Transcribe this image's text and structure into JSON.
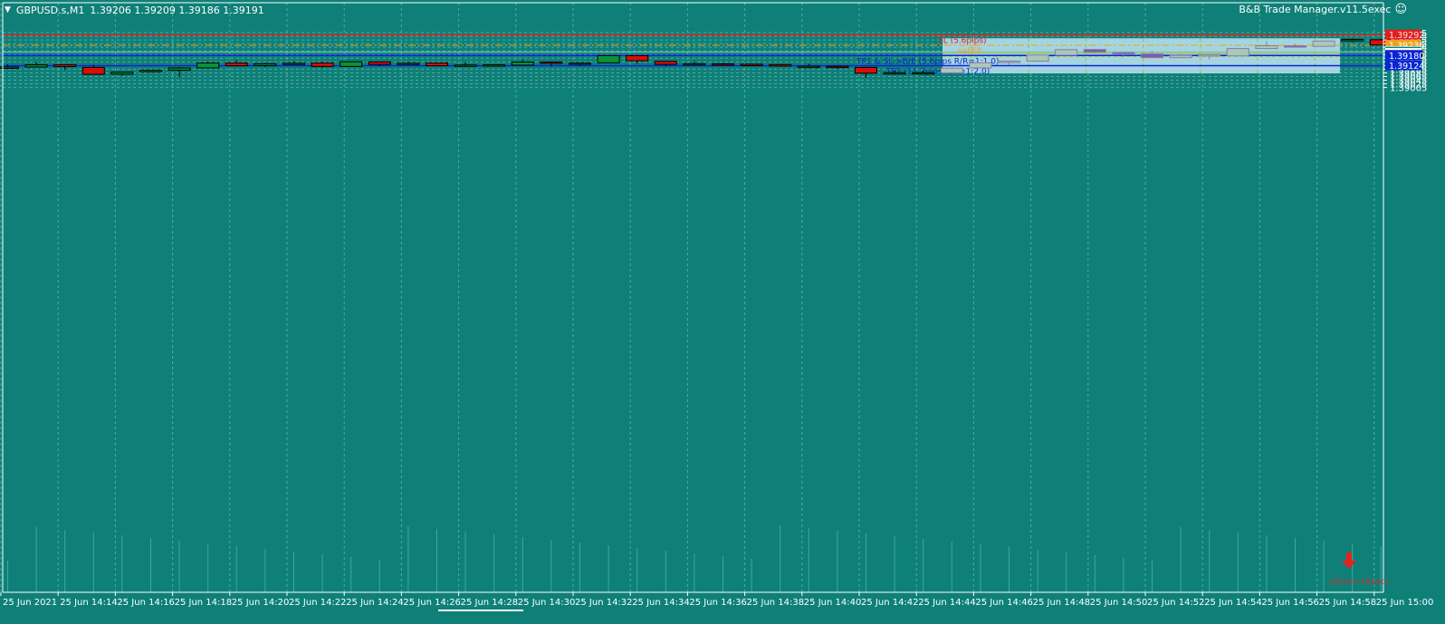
{
  "header": {
    "menu_icon": "triangle-down-icon",
    "symbol": "GBPUSD.s,M1",
    "ohlc": "1.39206 1.39209 1.39186 1.39191"
  },
  "expert_advisor": {
    "name": "B&B Trade Manager.v11.5exec",
    "icon": "smiley-icon"
  },
  "colors": {
    "background": "#0e8078",
    "bull": "#079438",
    "bear": "#d90d0a",
    "sl_line": "#e11f1f",
    "entry_line": "#f0a020",
    "tp_line": "#0a24d4",
    "grid": "#54a8a2",
    "zone": "#add8e6",
    "zone_bull": "#a9c9b8",
    "zone_bear": "#7b5fa8"
  },
  "price_axis": {
    "labels": [
      "1.39305",
      "1.39285",
      "1.39265",
      "1.39245",
      "1.39225",
      "1.39205",
      "1.39185",
      "1.39165",
      "1.39145",
      "1.39125",
      "1.39105",
      "1.39085",
      "1.39065",
      "1.39045",
      "1.39025",
      "1.39005"
    ]
  },
  "price_tags": [
    {
      "text": "1.39292",
      "price": 1.39292,
      "bg": "#e11f1f",
      "fg": "#ffdddd"
    },
    {
      "text": "1.39236",
      "price": 1.39236,
      "bg": "#f0a020",
      "fg": "#ffffff"
    },
    {
      "text": "1.39199",
      "price": 1.39199,
      "bg": "#0e8078",
      "fg": "#0e8078",
      "border": "#a8d8d4"
    },
    {
      "text": "1.39191",
      "price": 1.39191,
      "bg": "#ffffff",
      "fg": "#000000"
    },
    {
      "text": "1.39180",
      "price": 1.3918,
      "bg": "#0a24d4",
      "fg": "#ffffff"
    },
    {
      "text": "1.39124",
      "price": 1.39124,
      "bg": "#0a24d4",
      "fg": "#ffffff"
    }
  ],
  "lines": [
    {
      "name": "sl-line",
      "price": 1.39292,
      "label": "SL (5.6pips)",
      "color": "#e11f1f",
      "style": "solid"
    },
    {
      "name": "sell-entry-line",
      "price": 1.39236,
      "label": "sellEP",
      "color": "#f0a020",
      "style": "dashed"
    },
    {
      "name": "tp1-line",
      "price": 1.3918,
      "label": "TP1 & SL->B/E (5.6pips R/R=1:1.0)",
      "color": "#0a24d4",
      "style": "solid"
    },
    {
      "name": "tp2-line",
      "price": 1.39124,
      "label": "TP2 (11.2pips R/R=1:2.0)",
      "color": "#0a24d4",
      "style": "solid"
    }
  ],
  "time_axis": {
    "labels": [
      "25 Jun 2021",
      "25 Jun 14:14",
      "25 Jun 14:16",
      "25 Jun 14:18",
      "25 Jun 14:20",
      "25 Jun 14:22",
      "25 Jun 14:24",
      "25 Jun 14:26",
      "25 Jun 14:28",
      "25 Jun 14:30",
      "25 Jun 14:32",
      "25 Jun 14:34",
      "25 Jun 14:36",
      "25 Jun 14:38",
      "25 Jun 14:40",
      "25 Jun 14:42",
      "25 Jun 14:44",
      "25 Jun 14:46",
      "25 Jun 14:48",
      "25 Jun 14:50",
      "25 Jun 14:52",
      "25 Jun 14:54",
      "25 Jun 14:56",
      "25 Jun 14:58",
      "25 Jun 15:00"
    ]
  },
  "countdown": {
    "text": "(45min 18sec)",
    "icon": "red-down-arrow-icon"
  },
  "chart_data": {
    "type": "candlestick",
    "title": "GBPUSD.s,M1",
    "ylim": [
      1.39,
      1.39315
    ],
    "candles": [
      {
        "o": 1.39114,
        "h": 1.39132,
        "l": 1.3911,
        "c": 1.39117
      },
      {
        "o": 1.39117,
        "h": 1.39146,
        "l": 1.39115,
        "c": 1.39129
      },
      {
        "o": 1.39129,
        "h": 1.39131,
        "l": 1.39101,
        "c": 1.39119
      },
      {
        "o": 1.39115,
        "h": 1.39128,
        "l": 1.39074,
        "c": 1.39077
      },
      {
        "o": 1.39078,
        "h": 1.3909,
        "l": 1.39069,
        "c": 1.39089
      },
      {
        "o": 1.39091,
        "h": 1.39101,
        "l": 1.39086,
        "c": 1.39099
      },
      {
        "o": 1.39099,
        "h": 1.39117,
        "l": 1.39061,
        "c": 1.39112
      },
      {
        "o": 1.39112,
        "h": 1.39146,
        "l": 1.3911,
        "c": 1.39139
      },
      {
        "o": 1.39139,
        "h": 1.39154,
        "l": 1.39123,
        "c": 1.39124
      },
      {
        "o": 1.39125,
        "h": 1.39141,
        "l": 1.39117,
        "c": 1.39135
      },
      {
        "o": 1.39136,
        "h": 1.39149,
        "l": 1.39133,
        "c": 1.39138
      },
      {
        "o": 1.39139,
        "h": 1.39146,
        "l": 1.39113,
        "c": 1.3912
      },
      {
        "o": 1.3912,
        "h": 1.39146,
        "l": 1.39118,
        "c": 1.39146
      },
      {
        "o": 1.39145,
        "h": 1.39147,
        "l": 1.39121,
        "c": 1.39131
      },
      {
        "o": 1.39131,
        "h": 1.39145,
        "l": 1.39128,
        "c": 1.39138
      },
      {
        "o": 1.39139,
        "h": 1.39141,
        "l": 1.39121,
        "c": 1.39124
      },
      {
        "o": 1.39124,
        "h": 1.39146,
        "l": 1.39119,
        "c": 1.39128
      },
      {
        "o": 1.39129,
        "h": 1.3913,
        "l": 1.39126,
        "c": 1.39129
      },
      {
        "o": 1.39127,
        "h": 1.39156,
        "l": 1.39127,
        "c": 1.39144
      },
      {
        "o": 1.39144,
        "h": 1.39146,
        "l": 1.3912,
        "c": 1.39138
      },
      {
        "o": 1.39139,
        "h": 1.39142,
        "l": 1.39123,
        "c": 1.39139
      },
      {
        "o": 1.3914,
        "h": 1.39181,
        "l": 1.3914,
        "c": 1.39179
      },
      {
        "o": 1.39179,
        "h": 1.39181,
        "l": 1.39136,
        "c": 1.39151
      },
      {
        "o": 1.39148,
        "h": 1.39148,
        "l": 1.3912,
        "c": 1.39131
      },
      {
        "o": 1.39131,
        "h": 1.39149,
        "l": 1.3913,
        "c": 1.39135
      },
      {
        "o": 1.39134,
        "h": 1.39139,
        "l": 1.39121,
        "c": 1.39131
      },
      {
        "o": 1.39132,
        "h": 1.39134,
        "l": 1.39122,
        "c": 1.39131
      },
      {
        "o": 1.3913,
        "h": 1.39133,
        "l": 1.39122,
        "c": 1.39122
      },
      {
        "o": 1.39121,
        "h": 1.39135,
        "l": 1.3911,
        "c": 1.39121
      },
      {
        "o": 1.39121,
        "h": 1.39124,
        "l": 1.39106,
        "c": 1.39115
      },
      {
        "o": 1.39115,
        "h": 1.39115,
        "l": 1.39058,
        "c": 1.39083
      },
      {
        "o": 1.39083,
        "h": 1.39097,
        "l": 1.39075,
        "c": 1.39086
      },
      {
        "o": 1.39084,
        "h": 1.39096,
        "l": 1.3908,
        "c": 1.39086
      },
      {
        "o": 1.39085,
        "h": 1.39116,
        "l": 1.39082,
        "c": 1.39111
      },
      {
        "o": 1.39112,
        "h": 1.39141,
        "l": 1.39109,
        "c": 1.3914
      },
      {
        "o": 1.39141,
        "h": 1.3915,
        "l": 1.39129,
        "c": 1.39149
      },
      {
        "o": 1.39149,
        "h": 1.39184,
        "l": 1.39149,
        "c": 1.39182
      },
      {
        "o": 1.39181,
        "h": 1.39213,
        "l": 1.3918,
        "c": 1.39212
      },
      {
        "o": 1.39213,
        "h": 1.39213,
        "l": 1.39192,
        "c": 1.39198
      },
      {
        "o": 1.39196,
        "h": 1.39196,
        "l": 1.39172,
        "c": 1.39188
      },
      {
        "o": 1.39189,
        "h": 1.39202,
        "l": 1.39168,
        "c": 1.39168
      },
      {
        "o": 1.39168,
        "h": 1.39188,
        "l": 1.39166,
        "c": 1.3918
      },
      {
        "o": 1.39177,
        "h": 1.39187,
        "l": 1.39159,
        "c": 1.39185
      },
      {
        "o": 1.39178,
        "h": 1.39219,
        "l": 1.39173,
        "c": 1.39218
      },
      {
        "o": 1.39218,
        "h": 1.39257,
        "l": 1.3922,
        "c": 1.39233
      },
      {
        "o": 1.39233,
        "h": 1.39243,
        "l": 1.3923,
        "c": 1.39232
      },
      {
        "o": 1.3923,
        "h": 1.3926,
        "l": 1.3923,
        "c": 1.39259
      },
      {
        "o": 1.3926,
        "h": 1.39273,
        "l": 1.39253,
        "c": 1.39268
      },
      {
        "o": 1.39266,
        "h": 1.39271,
        "l": 1.39236,
        "c": 1.39237
      }
    ]
  }
}
